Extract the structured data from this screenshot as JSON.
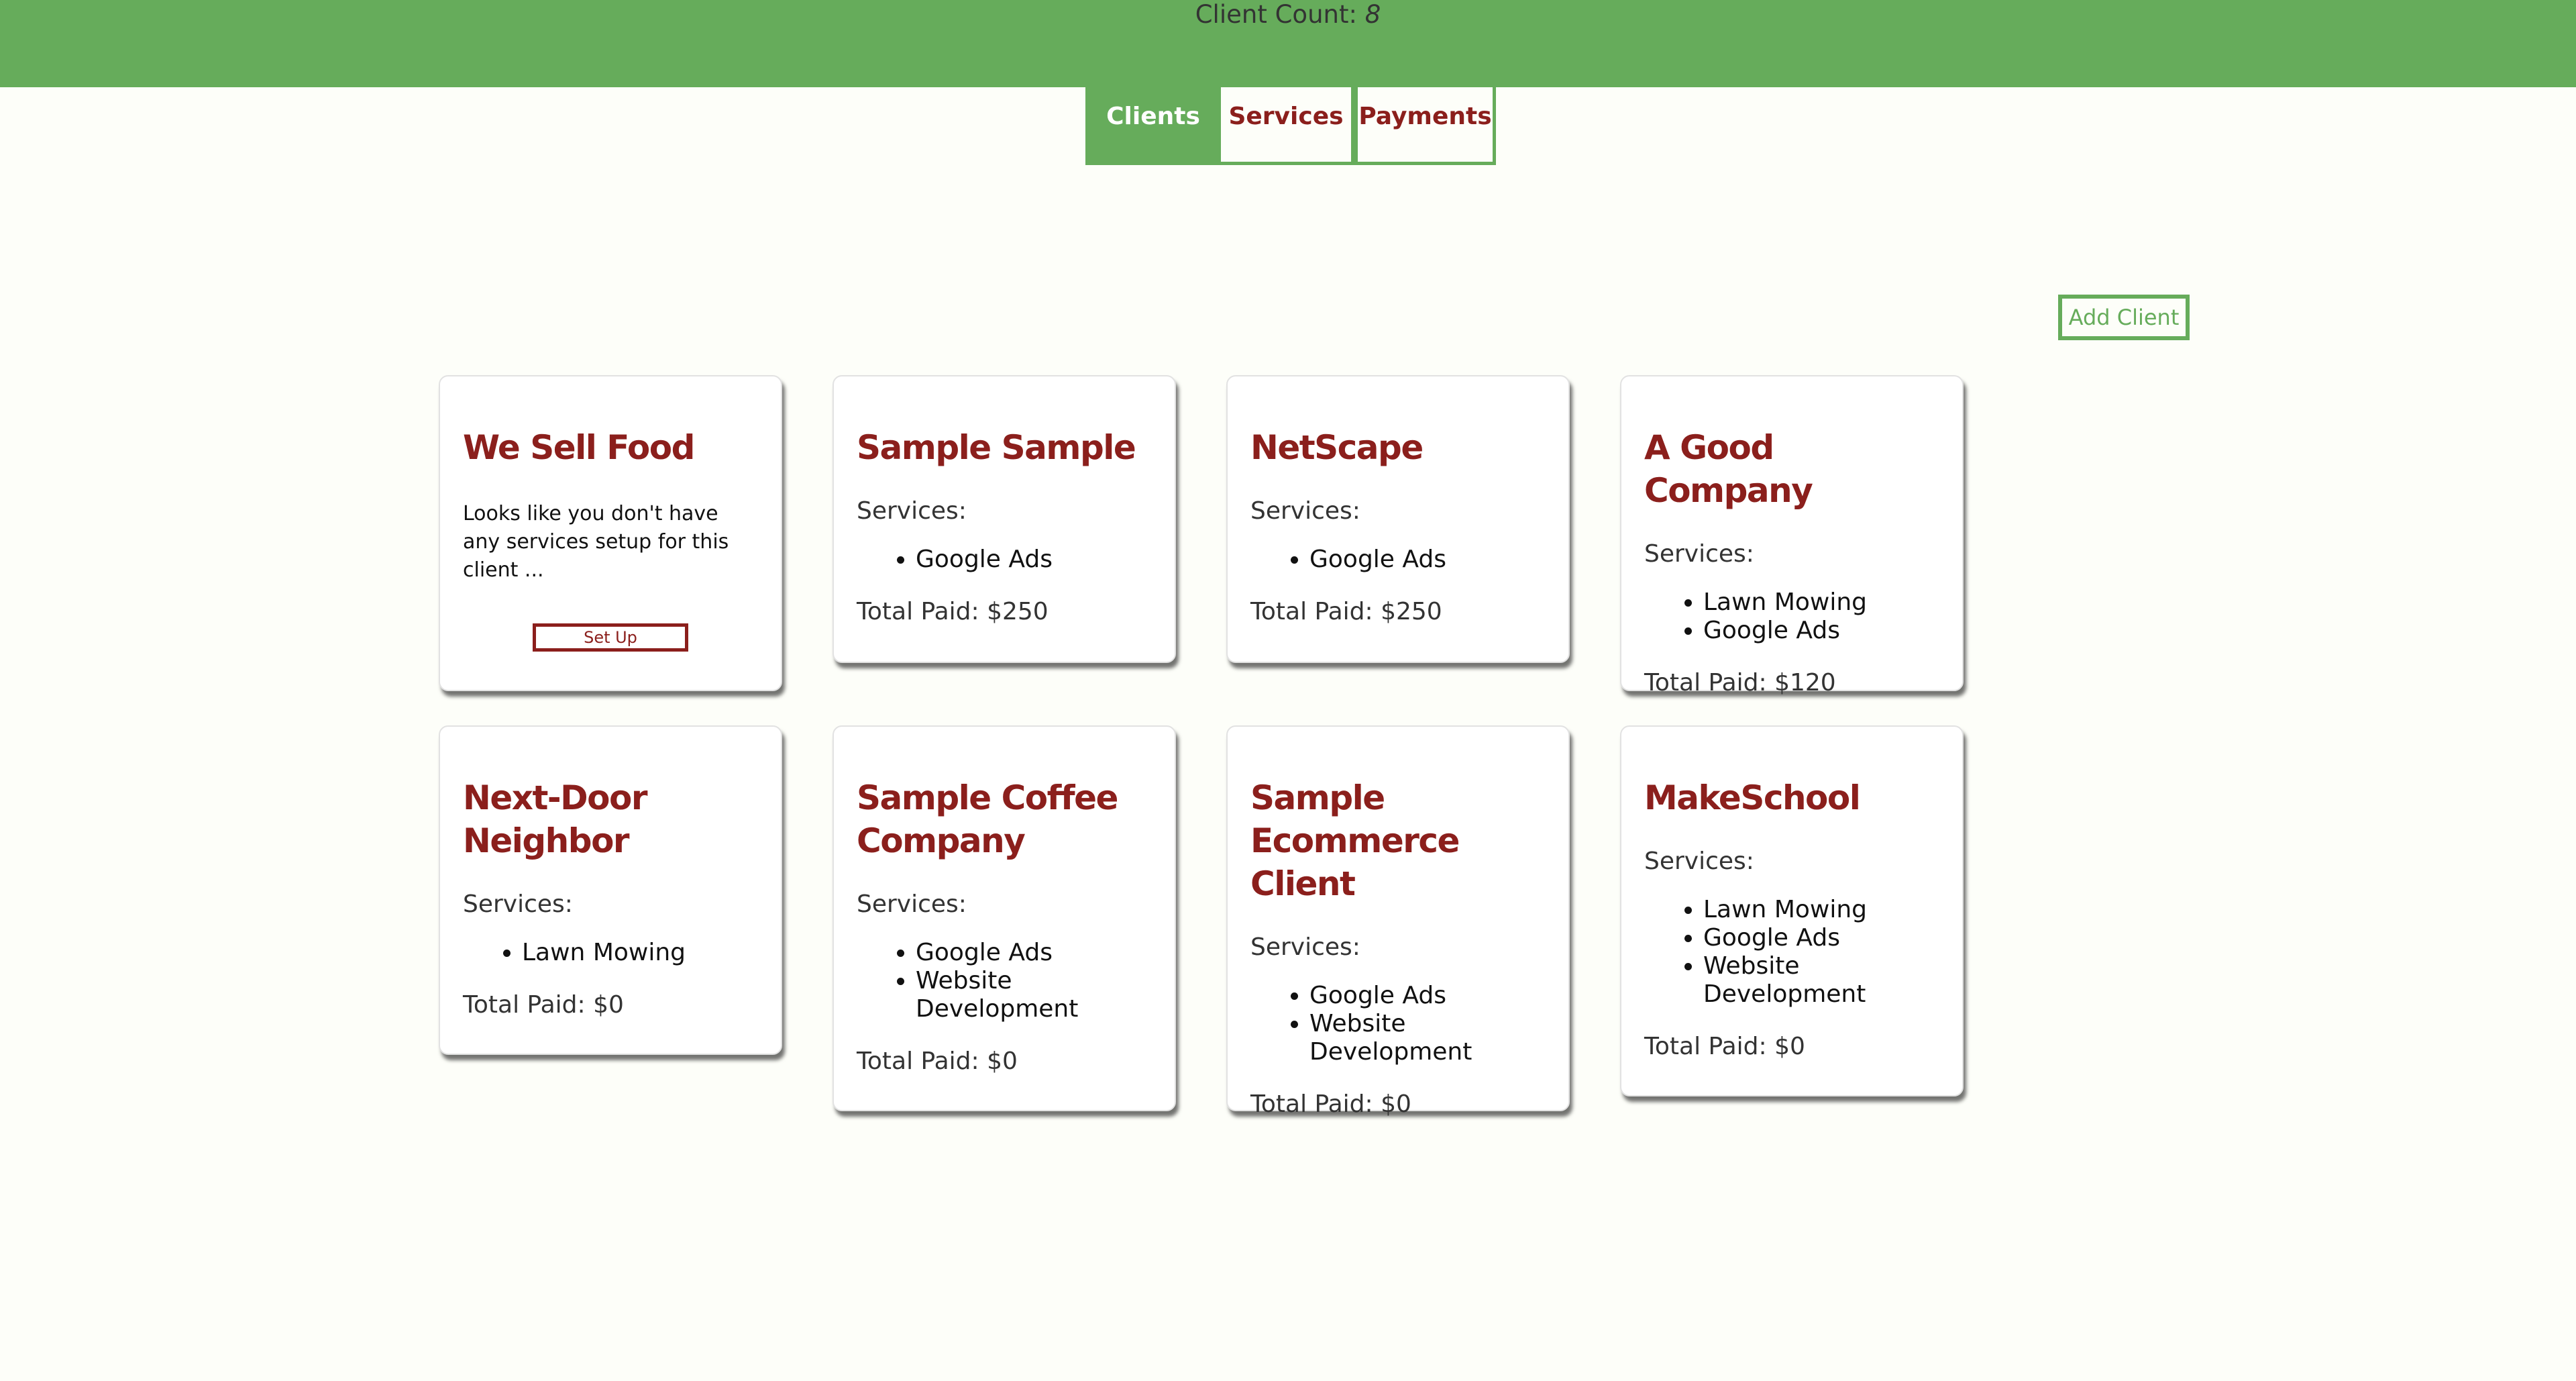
{
  "header": {
    "client_count_label": "Client Count:",
    "client_count_value": "8"
  },
  "tabs": [
    {
      "label": "Clients",
      "active": true
    },
    {
      "label": "Services",
      "active": false
    },
    {
      "label": "Payments",
      "active": false
    }
  ],
  "add_client_label": "Add Client",
  "colors": {
    "brand_green": "#66ac5b",
    "title_red": "#8b1f1c",
    "background": "#fdfef9"
  },
  "clients": [
    {
      "name": "We Sell Food",
      "empty_message": "Looks like you don't have any services setup for this client ...",
      "setup_label": "Set Up"
    },
    {
      "name": "Sample Sample",
      "services_label": "Services:",
      "services": [
        "Google Ads"
      ],
      "total_paid": "Total Paid: $250"
    },
    {
      "name": "NetScape",
      "services_label": "Services:",
      "services": [
        "Google Ads"
      ],
      "total_paid": "Total Paid: $250"
    },
    {
      "name": "A Good Company",
      "services_label": "Services:",
      "services": [
        "Lawn Mowing",
        "Google Ads"
      ],
      "total_paid": "Total Paid: $120"
    },
    {
      "name": "Next-Door Neighbor",
      "services_label": "Services:",
      "services": [
        "Lawn Mowing"
      ],
      "total_paid": "Total Paid: $0"
    },
    {
      "name": "Sample Coffee Company",
      "services_label": "Services:",
      "services": [
        "Google Ads",
        "Website Development"
      ],
      "total_paid": "Total Paid: $0"
    },
    {
      "name": "Sample Ecommerce Client",
      "services_label": "Services:",
      "services": [
        "Google Ads",
        "Website Development"
      ],
      "total_paid": "Total Paid: $0"
    },
    {
      "name": "MakeSchool",
      "services_label": "Services:",
      "services": [
        "Lawn Mowing",
        "Google Ads",
        "Website Development"
      ],
      "total_paid": "Total Paid: $0"
    }
  ]
}
